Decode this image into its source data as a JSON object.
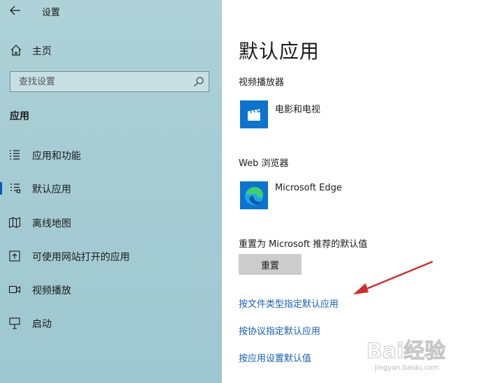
{
  "window": {
    "title": "设置"
  },
  "sidebar": {
    "home_label": "主页",
    "search_placeholder": "查找设置",
    "section_title": "应用",
    "items": [
      {
        "label": "应用和功能",
        "icon": "apps-list-icon",
        "selected": false
      },
      {
        "label": "默认应用",
        "icon": "default-apps-icon",
        "selected": true
      },
      {
        "label": "离线地图",
        "icon": "map-icon",
        "selected": false
      },
      {
        "label": "可使用网站打开的应用",
        "icon": "open-in-website-icon",
        "selected": false
      },
      {
        "label": "视频播放",
        "icon": "video-icon",
        "selected": false
      },
      {
        "label": "启动",
        "icon": "startup-icon",
        "selected": false
      }
    ]
  },
  "main": {
    "title": "默认应用",
    "video_player": {
      "label": "视频播放器",
      "app_name": "电影和电视",
      "icon": "movies-tv-icon"
    },
    "web_browser": {
      "label": "Web 浏览器",
      "app_name": "Microsoft Edge",
      "icon": "edge-icon"
    },
    "reset": {
      "label": "重置为 Microsoft 推荐的默认值",
      "button_label": "重置"
    },
    "links": [
      "按文件类型指定默认应用",
      "按协议指定默认应用",
      "按应用设置默认值"
    ]
  },
  "watermark": {
    "logo": "Bai经验",
    "url": "jingyan.baidu.com"
  },
  "colors": {
    "sidebar_bg": "#a7cdd4",
    "accent": "#0a58b8",
    "link": "#1360b6",
    "app_tile_blue": "#0b73d0",
    "annotation_arrow": "#d42a2a"
  }
}
